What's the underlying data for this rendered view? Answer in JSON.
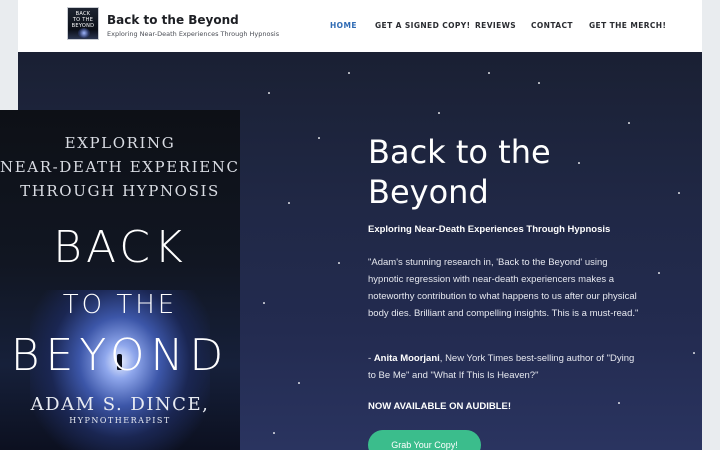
{
  "header": {
    "logo_lines": [
      "BACK",
      "TO THE",
      "BEYOND"
    ],
    "site_title": "Back to the Beyond",
    "site_tagline": "Exploring Near-Death Experiences Through Hypnosis",
    "nav": [
      {
        "label": "HOME",
        "active": true
      },
      {
        "label": "GET A SIGNED COPY!",
        "active": false
      },
      {
        "label": "REVIEWS",
        "active": false
      },
      {
        "label": "CONTACT",
        "active": false
      },
      {
        "label": "GET THE MERCH!",
        "active": false
      }
    ]
  },
  "book_cover": {
    "subtitle_lines": [
      "EXPLORING",
      "NEAR-DEATH EXPERIENCES",
      "THROUGH HYPNOSIS"
    ],
    "title_line1": "BACK",
    "title_line2": "TO THE",
    "title_line3": "BEYOND",
    "author": "ADAM S. DINCE,",
    "author_role": "HYPNOTHERAPIST"
  },
  "hero": {
    "heading_line1": "Back to the",
    "heading_line2": "Beyond",
    "subheading": "Exploring Near-Death Experiences Through Hypnosis",
    "quote": "\"Adam's stunning research in, 'Back to the Beyond' using hypnotic regression with near-death experiencers makes a noteworthy contribution to what happens to us after our physical body dies. Brilliant and compelling insights. This is a must-read.\"",
    "attribution_prefix": "- ",
    "attribution_name": "Anita Moorjani",
    "attribution_rest": ", New York Times best-selling author of \"Dying to Be Me\" and \"What If This Is Heaven?\"",
    "availability": "NOW AVAILABLE ON AUDIBLE!",
    "cta_label": "Grab Your Copy!"
  },
  "colors": {
    "nav_active": "#2f6bb4",
    "cta_bg": "#3bbd8c",
    "hero_bg": "#202846"
  }
}
